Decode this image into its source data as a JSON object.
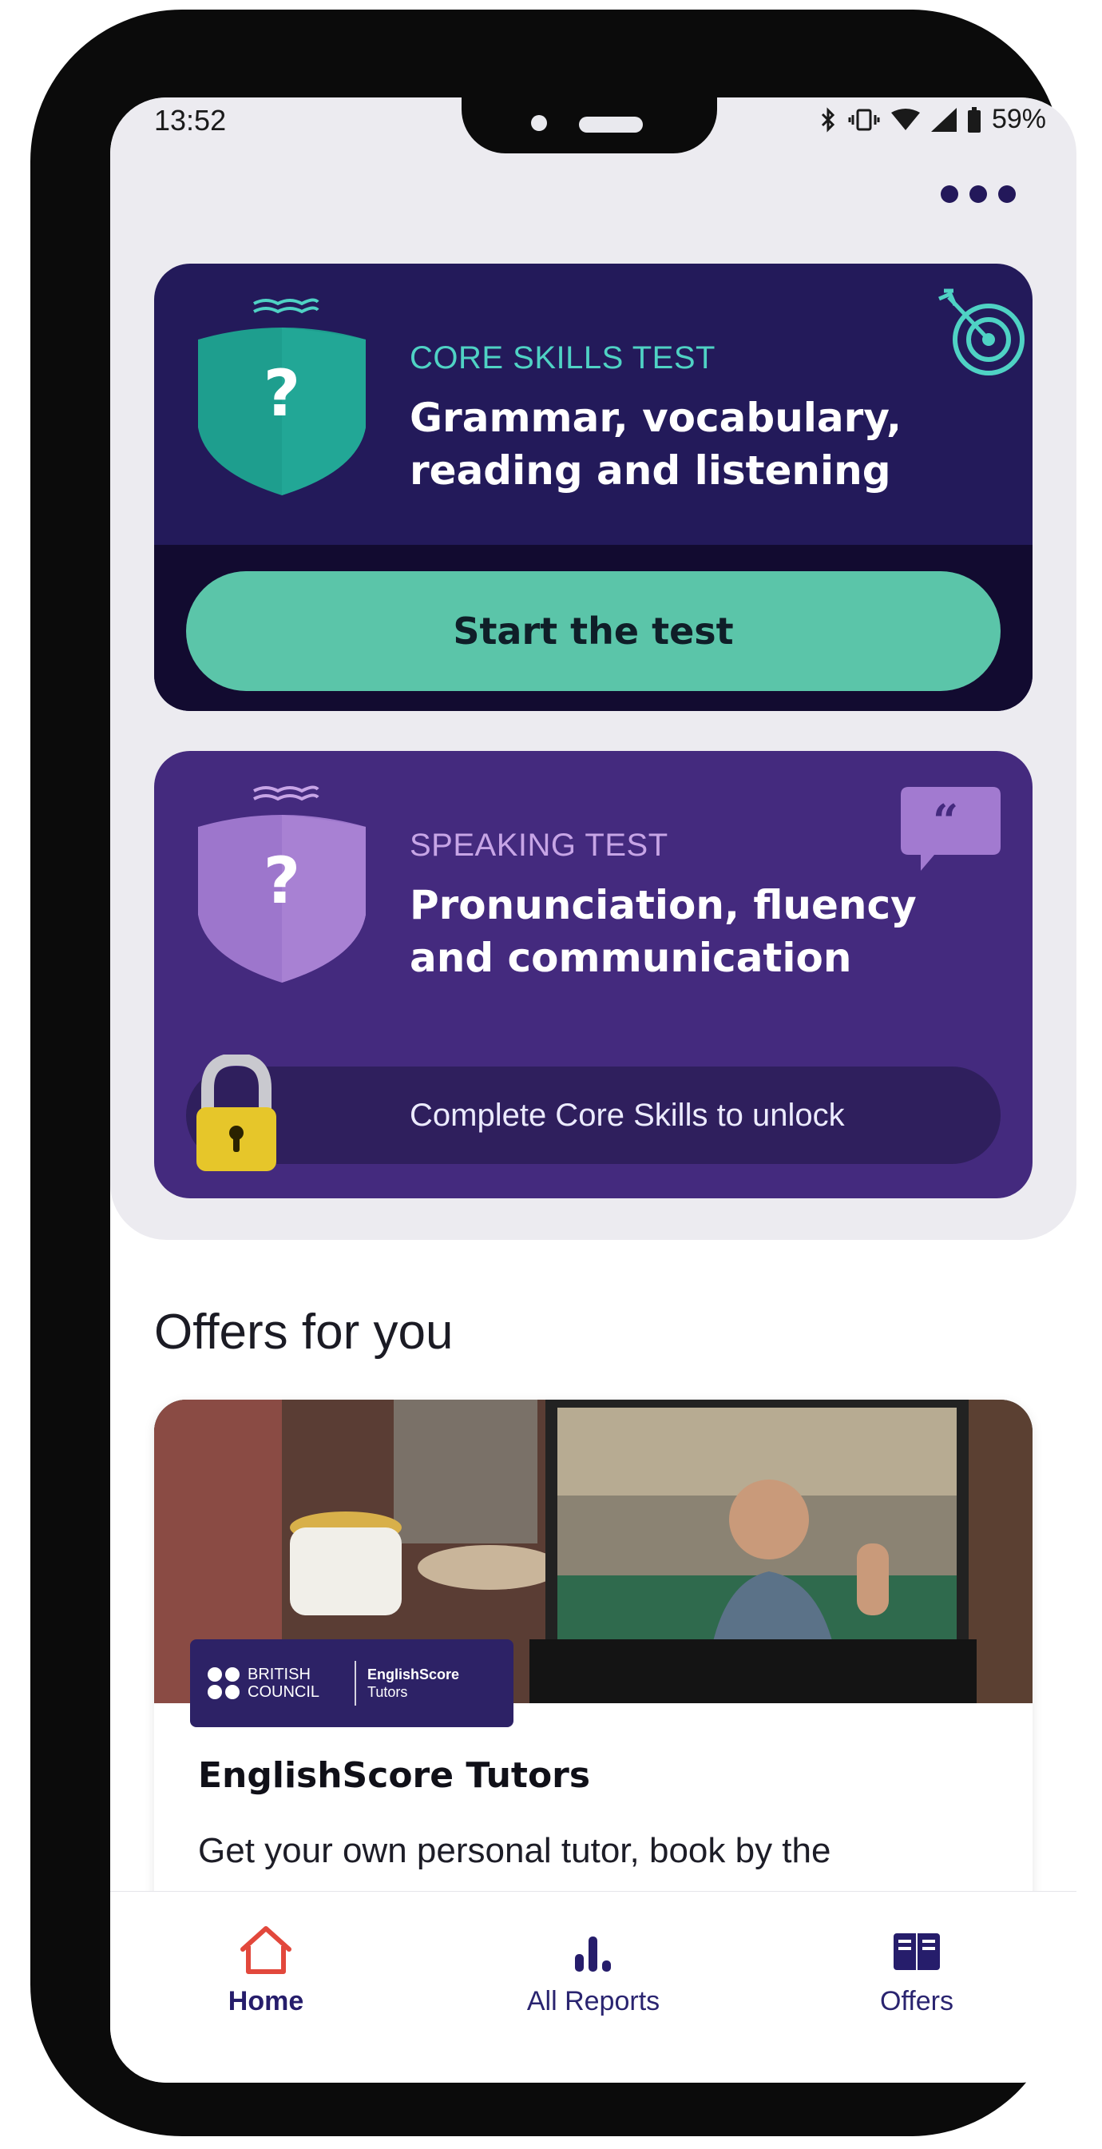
{
  "status_bar": {
    "time": "13:52",
    "battery": "59%"
  },
  "header": {
    "more_icon": "more-dots-icon"
  },
  "core_card": {
    "kicker": "CORE SKILLS TEST",
    "title": "Grammar, vocabulary, reading and listening",
    "button_label": "Start the test",
    "shield_symbol": "?",
    "icon": "target-icon",
    "colors": {
      "card": "#231a5a",
      "accent": "#4fd2c4",
      "button": "#5bc5a9"
    }
  },
  "speaking_card": {
    "kicker": "SPEAKING TEST",
    "title": "Pronunciation, fluency and communication",
    "lock_text": "Complete Core Skills to unlock",
    "shield_symbol": "?",
    "quote_mark": "“",
    "icon": "speech-bubble-icon",
    "colors": {
      "card": "#442a7e",
      "accent": "#c7a5e6",
      "lock": "#e6c62a"
    }
  },
  "offers": {
    "heading": "Offers for you",
    "items": [
      {
        "brand_name": "BRITISH COUNCIL",
        "product_name": "EnglishScore",
        "product_sub": "Tutors",
        "title": "EnglishScore Tutors",
        "description": "Get your own personal tutor, book by the"
      }
    ]
  },
  "bottom_nav": {
    "items": [
      {
        "label": "Home",
        "icon": "home-icon",
        "active": true
      },
      {
        "label": "All Reports",
        "icon": "bar-chart-icon",
        "active": false
      },
      {
        "label": "Offers",
        "icon": "open-book-icon",
        "active": false
      }
    ]
  }
}
